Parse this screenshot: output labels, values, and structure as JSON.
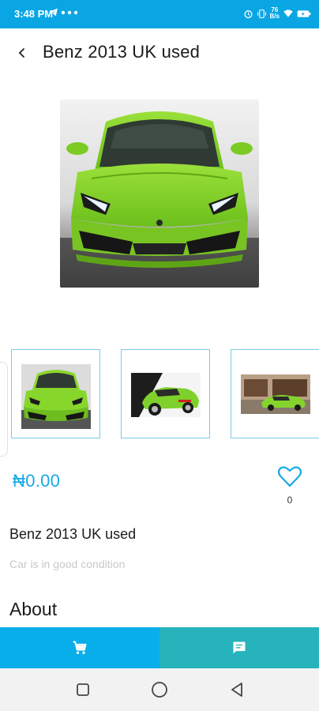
{
  "status_bar": {
    "time": "3:48 PM",
    "network": "76",
    "network_unit": "B/s",
    "icons_left": [
      "telegram-icon",
      "more-dots-icon"
    ],
    "icons_right": [
      "alarm-icon",
      "vibrate-icon",
      "wifi-icon",
      "battery-charging-icon"
    ]
  },
  "header": {
    "title": "Benz 2013 UK used",
    "back_icon": "chevron-left-icon"
  },
  "product": {
    "price": "₦0.00",
    "likes": "0",
    "name": "Benz 2013 UK used",
    "description": "Car is in good condition",
    "about_heading": "About"
  },
  "gallery": {
    "thumbnails": [
      "green-car-front",
      "green-car-rear-studio",
      "green-car-driveway"
    ]
  },
  "action_bar": {
    "cart_icon": "cart-icon",
    "chat_icon": "chat-icon",
    "cart_color": "#08aee9",
    "chat_color": "#26b3bc"
  },
  "nav_bar": {
    "icons": [
      "square-recent-icon",
      "circle-home-icon",
      "triangle-back-icon"
    ]
  },
  "colors": {
    "accent": "#15a9e6",
    "status_bar": "#0aa6e4",
    "car_green": "#86d62b"
  }
}
